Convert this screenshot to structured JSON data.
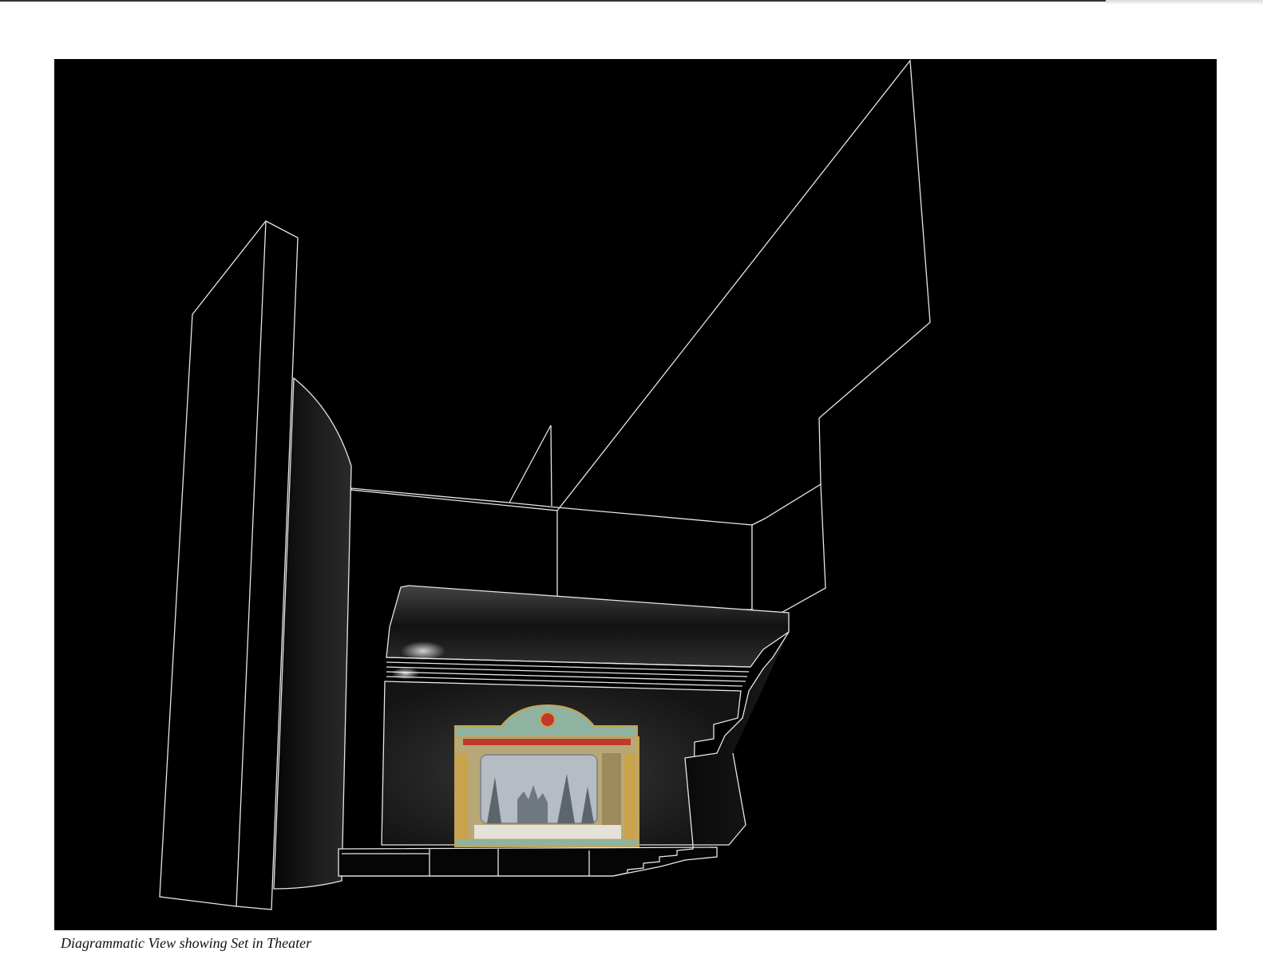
{
  "figure": {
    "caption": "Diagrammatic View showing Set in Theater",
    "background_color": "#000000",
    "line_color": "#e6e6e6",
    "proscenium_colors": {
      "frame": "#b8a878",
      "panel": "#8fb3a0",
      "accent": "#c0392b",
      "gold": "#c9a24a",
      "backdrop": "#b5bcc4"
    }
  }
}
